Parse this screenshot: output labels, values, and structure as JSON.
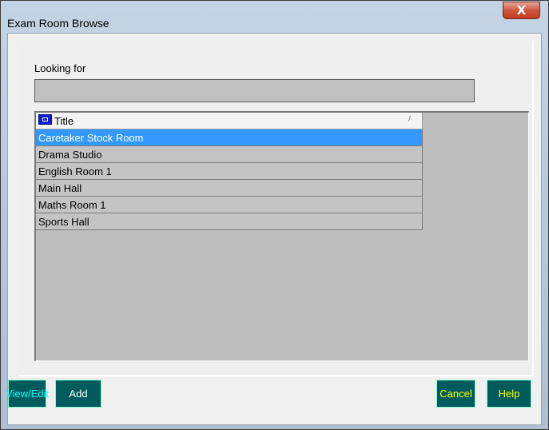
{
  "window": {
    "title": "Exam Room Browse",
    "close_glyph": "X"
  },
  "search": {
    "label": "Looking for",
    "value": ""
  },
  "grid": {
    "column_title": "Title",
    "sort_indicator": "/",
    "selected_index": 0,
    "rows": [
      "Caretaker Stock Room",
      "Drama Studio",
      "English Room 1",
      "Main Hall",
      "Maths Room 1",
      "Sports Hall"
    ]
  },
  "buttons": {
    "view_edit": "View/Edit",
    "add": "Add",
    "cancel": "Cancel",
    "help": "Help"
  },
  "colors": {
    "selection": "#3399ff",
    "button_bg": "#005c5c"
  }
}
